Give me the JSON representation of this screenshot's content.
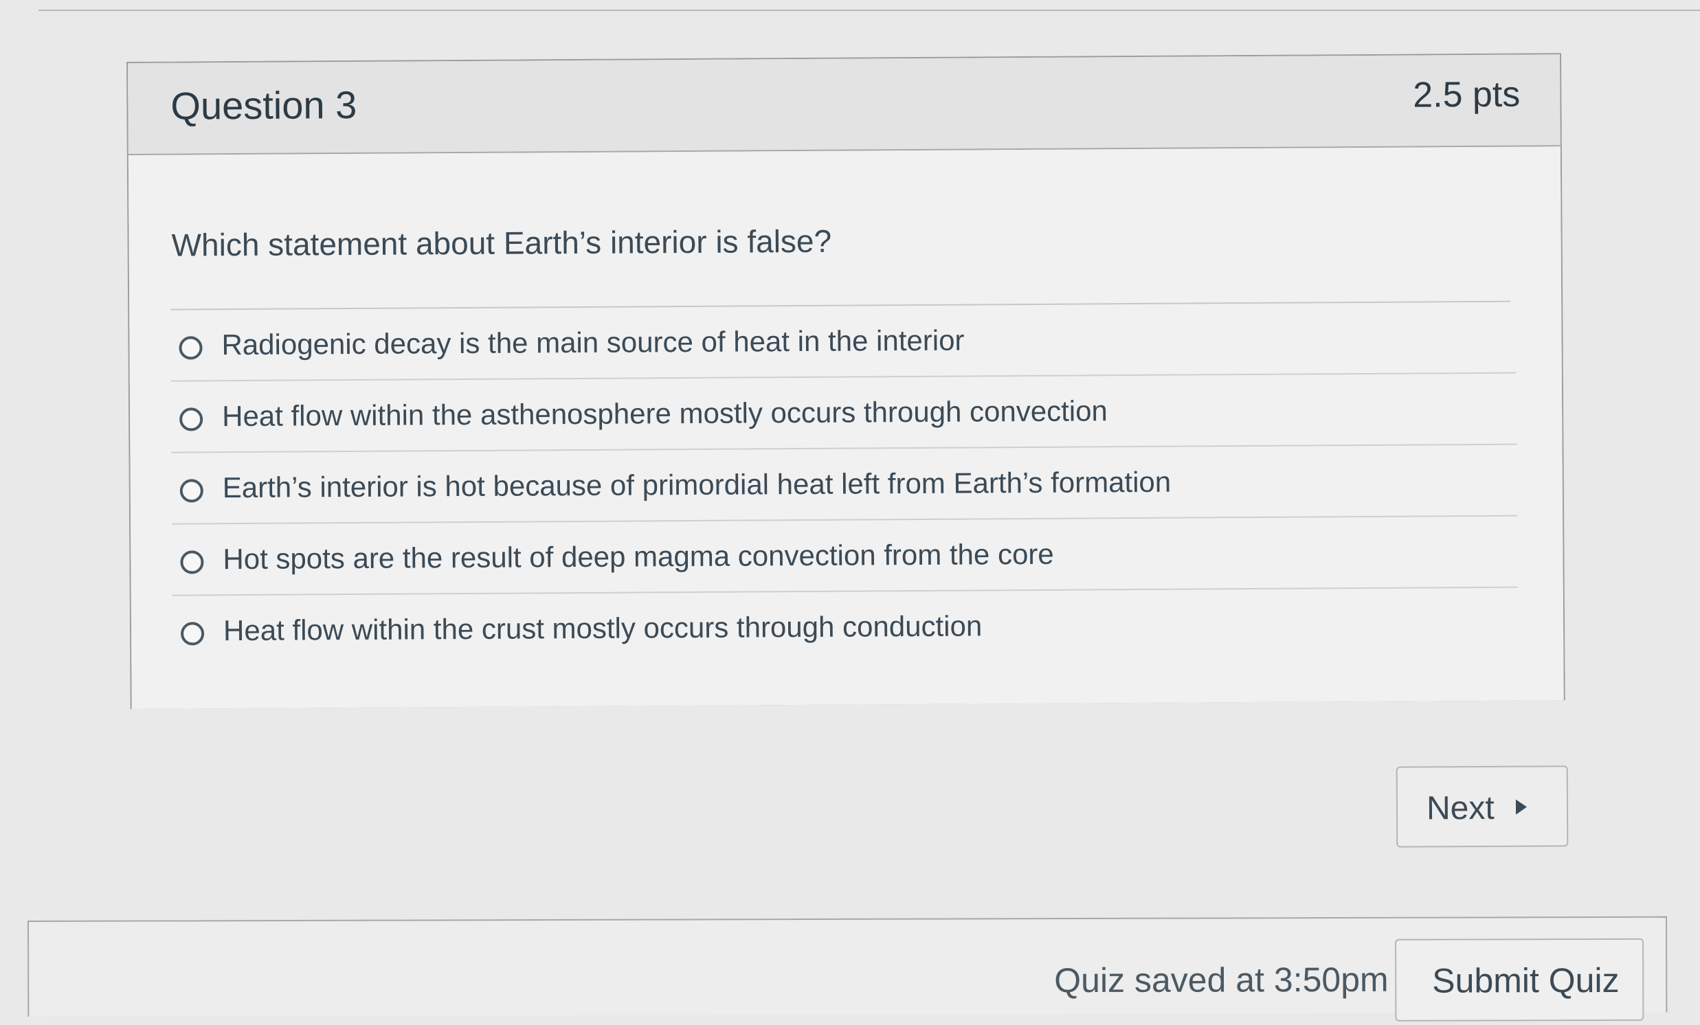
{
  "question": {
    "title": "Question 3",
    "points": "2.5 pts",
    "text": "Which statement about Earth’s interior is false?",
    "answers": [
      {
        "label": "Radiogenic decay is the main source of heat in the interior",
        "selected": false
      },
      {
        "label": "Heat flow within the asthenosphere mostly occurs through convection",
        "selected": false
      },
      {
        "label": "Earth’s interior is hot because of primordial heat left from Earth’s formation",
        "selected": false
      },
      {
        "label": "Hot spots are the result of deep magma convection from the core",
        "selected": false
      },
      {
        "label": "Heat flow within the crust mostly occurs through conduction",
        "selected": false
      }
    ]
  },
  "navigation": {
    "next_label": "Next",
    "next_icon": "play-triangle-icon"
  },
  "footer": {
    "saved_status": "Quiz saved at 3:50pm",
    "submit_label": "Submit Quiz"
  }
}
